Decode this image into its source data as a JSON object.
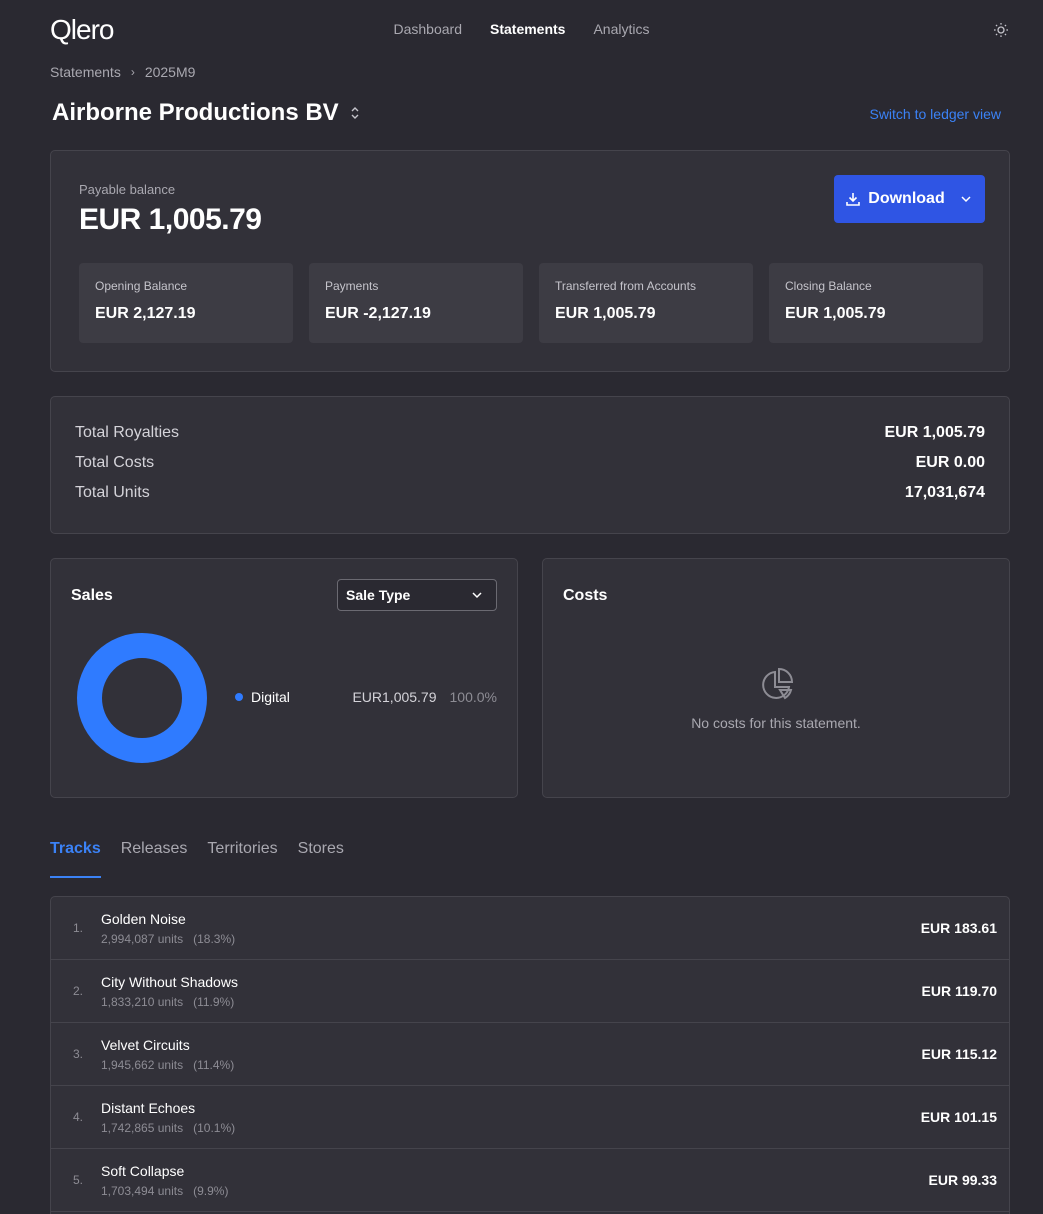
{
  "header": {
    "logo": "Qlero",
    "nav": [
      "Dashboard",
      "Statements",
      "Analytics"
    ],
    "nav_active": 1
  },
  "breadcrumb": {
    "root": "Statements",
    "separator": "›",
    "current": "2025M9"
  },
  "page": {
    "title": "Airborne Productions BV",
    "ledger_link": "Switch to ledger view"
  },
  "balance": {
    "label": "Payable balance",
    "value": "EUR 1,005.79",
    "download_label": "Download",
    "stats": [
      {
        "label": "Opening Balance",
        "value": "EUR 2,127.19"
      },
      {
        "label": "Payments",
        "value": "EUR -2,127.19"
      },
      {
        "label": "Transferred from Accounts",
        "value": "EUR 1,005.79"
      },
      {
        "label": "Closing Balance",
        "value": "EUR 1,005.79"
      }
    ]
  },
  "totals": [
    {
      "label": "Total Royalties",
      "value": "EUR 1,005.79"
    },
    {
      "label": "Total Costs",
      "value": "EUR 0.00"
    },
    {
      "label": "Total Units",
      "value": "17,031,674"
    }
  ],
  "sales": {
    "title": "Sales",
    "select_value": "Sale Type",
    "legend": [
      {
        "name": "Digital",
        "amount": "EUR1,005.79",
        "pct": "100.0%",
        "fraction": 1.0,
        "color": "#2f7bff"
      }
    ]
  },
  "costs": {
    "title": "Costs",
    "empty_text": "No costs for this statement."
  },
  "tabs": [
    "Tracks",
    "Releases",
    "Territories",
    "Stores"
  ],
  "tab_active": 0,
  "tracks": [
    {
      "num": "1.",
      "name": "Golden Noise",
      "units": "2,994,087 units",
      "pct": "(18.3%)",
      "amount": "EUR 183.61"
    },
    {
      "num": "2.",
      "name": "City Without Shadows",
      "units": "1,833,210 units",
      "pct": "(11.9%)",
      "amount": "EUR 119.70"
    },
    {
      "num": "3.",
      "name": "Velvet Circuits",
      "units": "1,945,662 units",
      "pct": "(11.4%)",
      "amount": "EUR 115.12"
    },
    {
      "num": "4.",
      "name": "Distant Echoes",
      "units": "1,742,865 units",
      "pct": "(10.1%)",
      "amount": "EUR 101.15"
    },
    {
      "num": "5.",
      "name": "Soft Collapse",
      "units": "1,703,494 units",
      "pct": "(9.9%)",
      "amount": "EUR 99.33"
    }
  ],
  "colors": {
    "accent": "#2f55e4",
    "link": "#3b82f6",
    "background": "#2a2931",
    "card": "#323139"
  },
  "icons": [
    "sun-icon",
    "chevron-up-down-icon",
    "download-icon",
    "chevron-down-icon",
    "pie-chart-icon"
  ]
}
